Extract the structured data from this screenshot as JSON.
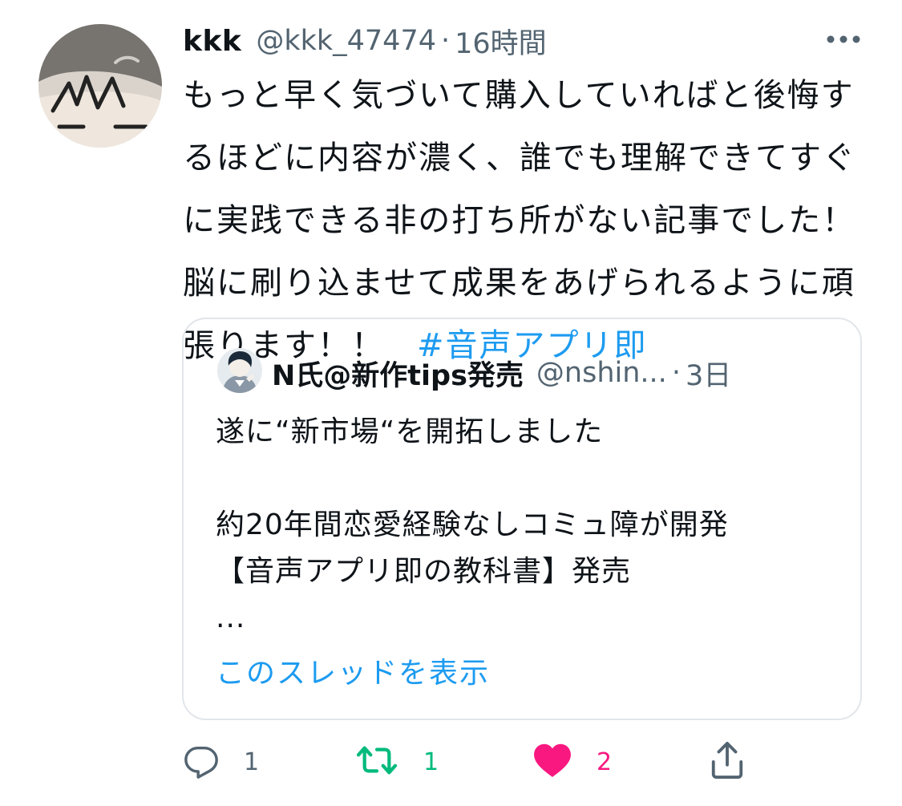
{
  "tweet": {
    "author": {
      "display_name": "kkk",
      "handle": "@kkk_47474",
      "separator": "·",
      "time": "16時間"
    },
    "text_lines": [
      "もっと早く気づいて購入していればと後悔す",
      "るほどに内容が濃く、誰でも理解できてすぐ",
      "に実践できる非の打ち所がない記事でした！",
      "脳に刷り込ませて成果をあげられるように頑",
      "張ります！！"
    ],
    "hashtag": "#音声アプリ即"
  },
  "quote": {
    "author": {
      "display_name": "N氏@新作tips発売",
      "handle": "@nshin...",
      "separator": "·",
      "time": "3日"
    },
    "text_lines": [
      "遂に“新市場“を開拓しました",
      "",
      "約20年間恋愛経験なしコミュ障が開発",
      "【音声アプリ即の教科書】発売",
      "..."
    ],
    "show_thread_label": "このスレッドを表示"
  },
  "actions": {
    "reply_count": "1",
    "retweet_count": "1",
    "like_count": "2"
  },
  "colors": {
    "accent": "#1d9bf0",
    "secondary_text": "#536471",
    "retweet_green": "#00ba7c",
    "like_pink": "#f91880",
    "border": "#e2e6ea"
  },
  "icons": {
    "more": "more-horizontal-icon",
    "reply": "reply-icon",
    "retweet": "retweet-icon",
    "like": "heart-icon",
    "share": "share-icon"
  }
}
